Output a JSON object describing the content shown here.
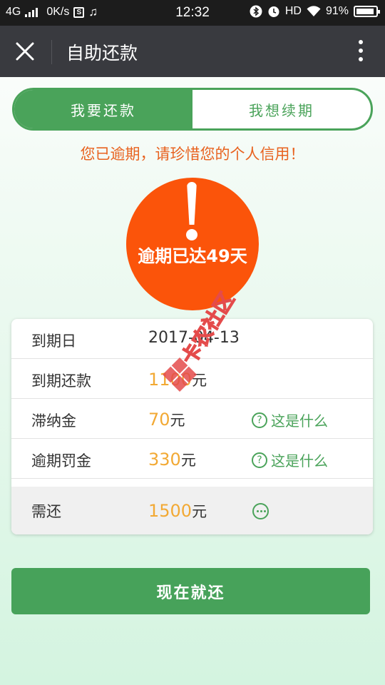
{
  "status_bar": {
    "network": "4G",
    "speed": "0K/s",
    "time": "12:32",
    "hd": "HD",
    "battery": "91%",
    "battery_level": 0.91,
    "icons": [
      "signal-icon",
      "s-box-icon",
      "music-icon",
      "bluetooth-icon",
      "alarm-icon",
      "wifi-icon",
      "battery-icon"
    ]
  },
  "nav": {
    "title": "自助还款",
    "icons": [
      "close-icon",
      "more-vertical-icon"
    ]
  },
  "tabs": [
    {
      "label": "我要还款",
      "active": true
    },
    {
      "label": "我想续期",
      "active": false
    }
  ],
  "warning": "您已逾期，请珍惜您的个人信用！",
  "overdue": {
    "text": "逾期已达49天",
    "icon": "exclamation-icon",
    "color": "#fb540a"
  },
  "details": {
    "due_date": {
      "label": "到期日",
      "value": "2017-04-13"
    },
    "due_amount": {
      "label": "到期还款",
      "amount": "1100",
      "unit": "元"
    },
    "late_fee": {
      "label": "滞纳金",
      "amount": "70",
      "unit": "元",
      "help": "这是什么"
    },
    "penalty": {
      "label": "逾期罚金",
      "amount": "330",
      "unit": "元",
      "help": "这是什么"
    },
    "total": {
      "label": "需还",
      "amount": "1500",
      "unit": "元",
      "icon": "more-horizontal-icon"
    }
  },
  "watermark": {
    "text": "卡农社区"
  },
  "pay_button": {
    "label": "现在就还"
  },
  "colors": {
    "accent_green": "#4aa35a",
    "amount_orange": "#f2a934",
    "warning_orange": "#e8621f",
    "nav_bg": "#393a3f"
  }
}
